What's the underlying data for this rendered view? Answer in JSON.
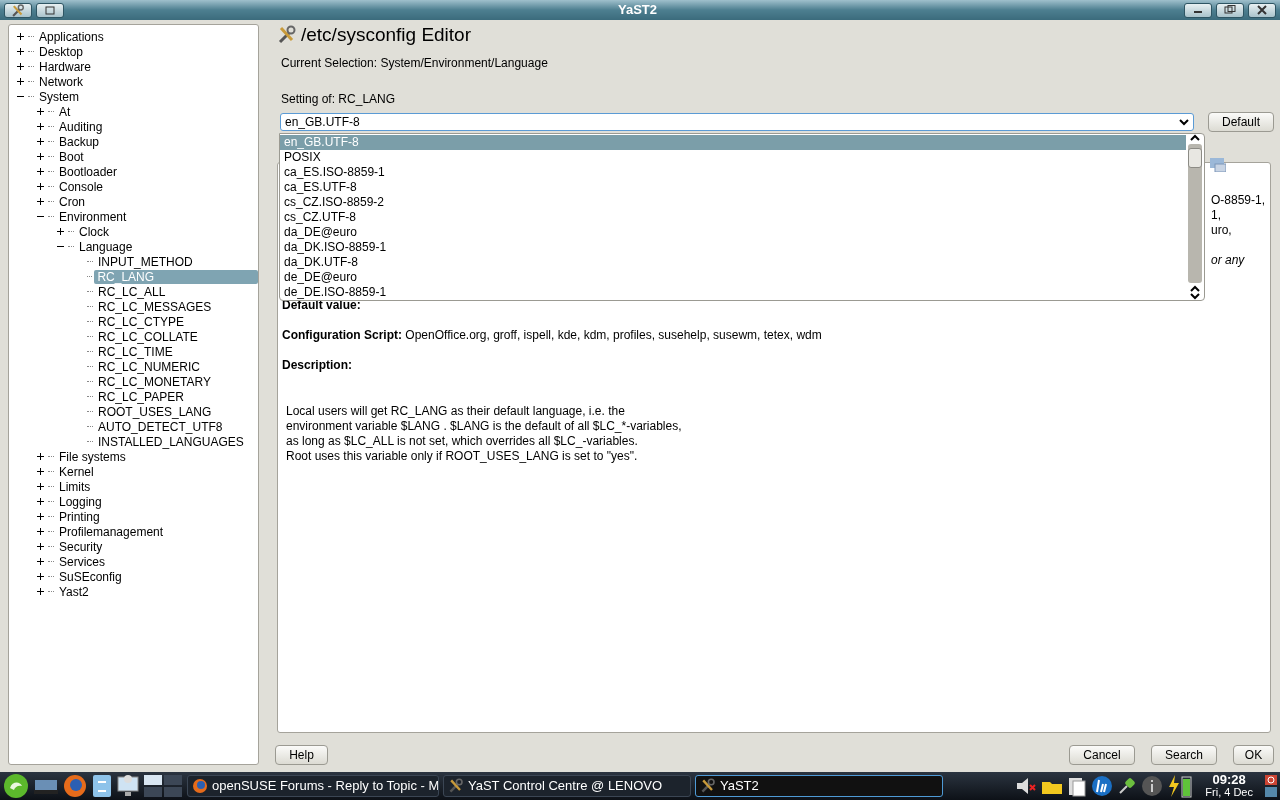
{
  "window": {
    "title": "YaST2"
  },
  "tree": [
    {
      "label": "Applications",
      "expanded": false,
      "selected": false
    },
    {
      "label": "Desktop",
      "expanded": false,
      "selected": false
    },
    {
      "label": "Hardware",
      "expanded": false,
      "selected": false
    },
    {
      "label": "Network",
      "expanded": false,
      "selected": false
    },
    {
      "label": "System",
      "expanded": true,
      "selected": false,
      "children": [
        {
          "label": "At",
          "expanded": false,
          "selected": false
        },
        {
          "label": "Auditing",
          "expanded": false,
          "selected": false
        },
        {
          "label": "Backup",
          "expanded": false,
          "selected": false
        },
        {
          "label": "Boot",
          "expanded": false,
          "selected": false
        },
        {
          "label": "Bootloader",
          "expanded": false,
          "selected": false
        },
        {
          "label": "Console",
          "expanded": false,
          "selected": false
        },
        {
          "label": "Cron",
          "expanded": false,
          "selected": false
        },
        {
          "label": "Environment",
          "expanded": true,
          "selected": false,
          "children": [
            {
              "label": "Clock",
              "expanded": false,
              "selected": false
            },
            {
              "label": "Language",
              "expanded": true,
              "selected": false,
              "children": [
                {
                  "label": "INPUT_METHOD",
                  "selected": false
                },
                {
                  "label": "RC_LANG",
                  "selected": true
                },
                {
                  "label": "RC_LC_ALL",
                  "selected": false
                },
                {
                  "label": "RC_LC_MESSAGES",
                  "selected": false
                },
                {
                  "label": "RC_LC_CTYPE",
                  "selected": false
                },
                {
                  "label": "RC_LC_COLLATE",
                  "selected": false
                },
                {
                  "label": "RC_LC_TIME",
                  "selected": false
                },
                {
                  "label": "RC_LC_NUMERIC",
                  "selected": false
                },
                {
                  "label": "RC_LC_MONETARY",
                  "selected": false
                },
                {
                  "label": "RC_LC_PAPER",
                  "selected": false
                },
                {
                  "label": "ROOT_USES_LANG",
                  "selected": false
                },
                {
                  "label": "AUTO_DETECT_UTF8",
                  "selected": false
                },
                {
                  "label": "INSTALLED_LANGUAGES",
                  "selected": false
                }
              ]
            }
          ]
        },
        {
          "label": "File systems",
          "expanded": false,
          "selected": false
        },
        {
          "label": "Kernel",
          "expanded": false,
          "selected": false
        },
        {
          "label": "Limits",
          "expanded": false,
          "selected": false
        },
        {
          "label": "Logging",
          "expanded": false,
          "selected": false
        },
        {
          "label": "Printing",
          "expanded": false,
          "selected": false
        },
        {
          "label": "Profilemanagement",
          "expanded": false,
          "selected": false
        },
        {
          "label": "Security",
          "expanded": false,
          "selected": false
        },
        {
          "label": "Services",
          "expanded": false,
          "selected": false
        },
        {
          "label": "SuSEconfig",
          "expanded": false,
          "selected": false
        },
        {
          "label": "Yast2",
          "expanded": false,
          "selected": false
        }
      ]
    }
  ],
  "heading": "/etc/sysconfig Editor",
  "current_selection": "Current Selection: System/Environment/Language",
  "setting_label": "Setting of: RC_LANG",
  "setting_value": "en_GB.UTF-8",
  "default_button": "Default",
  "dropdown_options": [
    {
      "label": "en_GB.UTF-8",
      "selected": true
    },
    {
      "label": "POSIX",
      "selected": false
    },
    {
      "label": "ca_ES.ISO-8859-1",
      "selected": false
    },
    {
      "label": "ca_ES.UTF-8",
      "selected": false
    },
    {
      "label": "cs_CZ.ISO-8859-2",
      "selected": false
    },
    {
      "label": "cs_CZ.UTF-8",
      "selected": false
    },
    {
      "label": "da_DE@euro",
      "selected": false
    },
    {
      "label": "da_DK.ISO-8859-1",
      "selected": false
    },
    {
      "label": "da_DK.UTF-8",
      "selected": false
    },
    {
      "label": "de_DE@euro",
      "selected": false
    },
    {
      "label": "de_DE.ISO-8859-1",
      "selected": false
    }
  ],
  "info": {
    "hidden_fragments": [
      {
        "text": "O-8859-1,",
        "kind": "plain"
      },
      {
        "text": "1,",
        "kind": "plain"
      },
      {
        "text": "uro,",
        "kind": "plain"
      },
      {
        "text": "or any",
        "kind": "italic"
      }
    ],
    "default_value_label": "Default value:",
    "config_script": "**Configuration Script:** OpenOffice.org, groff, ispell, kde, kdm, profiles, susehelp, susewm, tetex, wdm",
    "description_label": "Description:",
    "description": "Local users will get RC_LANG as their default language, i.e. the\nenvironment variable $LANG . $LANG is the default of all $LC_*-variables,\nas long as $LC_ALL is not set, which overrides all $LC_-variables.\nRoot uses this variable only if ROOT_USES_LANG is set to \"yes\"."
  },
  "buttons": {
    "help": "Help",
    "cancel": "Cancel",
    "search": "Search",
    "ok": "OK"
  },
  "taskbar": {
    "tasks": [
      {
        "label": "openSUSE Forums - Reply to Topic - M",
        "selected": false
      },
      {
        "label": "YaST Control Centre @ LENOVO",
        "selected": false
      },
      {
        "label": "YaST2",
        "selected": true
      }
    ],
    "clock": {
      "time": "09:28",
      "date": "Fri, 4 Dec"
    }
  }
}
